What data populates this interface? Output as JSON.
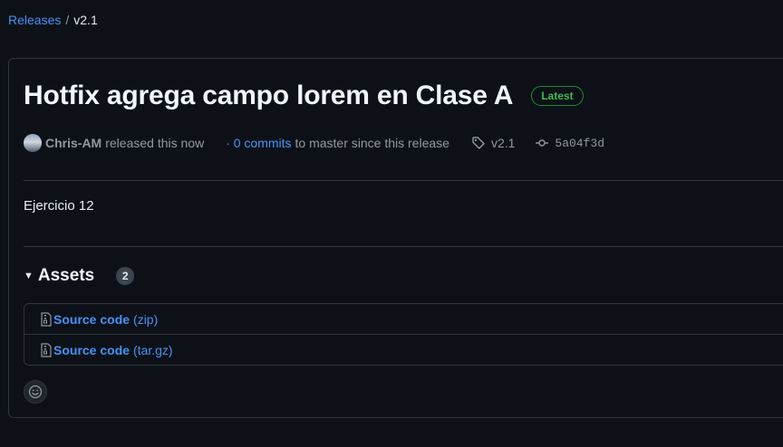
{
  "breadcrumb": {
    "releases_label": "Releases",
    "separator": "/",
    "current": "v2.1"
  },
  "release": {
    "title": "Hotfix agrega campo lorem en Clase A",
    "latest_badge": "Latest",
    "author": "Chris-AM",
    "released_text": "released this now",
    "commits_link": "· 0 commits",
    "commits_rest": "to master since this release",
    "tag": "v2.1",
    "commit_sha": "5a04f3d",
    "body": "Ejercicio 12"
  },
  "assets": {
    "title": "Assets",
    "count": "2",
    "items": [
      {
        "name": "Source code",
        "ext": "(zip)",
        "icon": "file-zip-icon"
      },
      {
        "name": "Source code",
        "ext": "(tar.gz)",
        "icon": "file-zip-icon"
      }
    ]
  },
  "colors": {
    "background": "#0d1117",
    "link": "#4493f8",
    "latest": "#3fb950",
    "border": "#30363d"
  }
}
